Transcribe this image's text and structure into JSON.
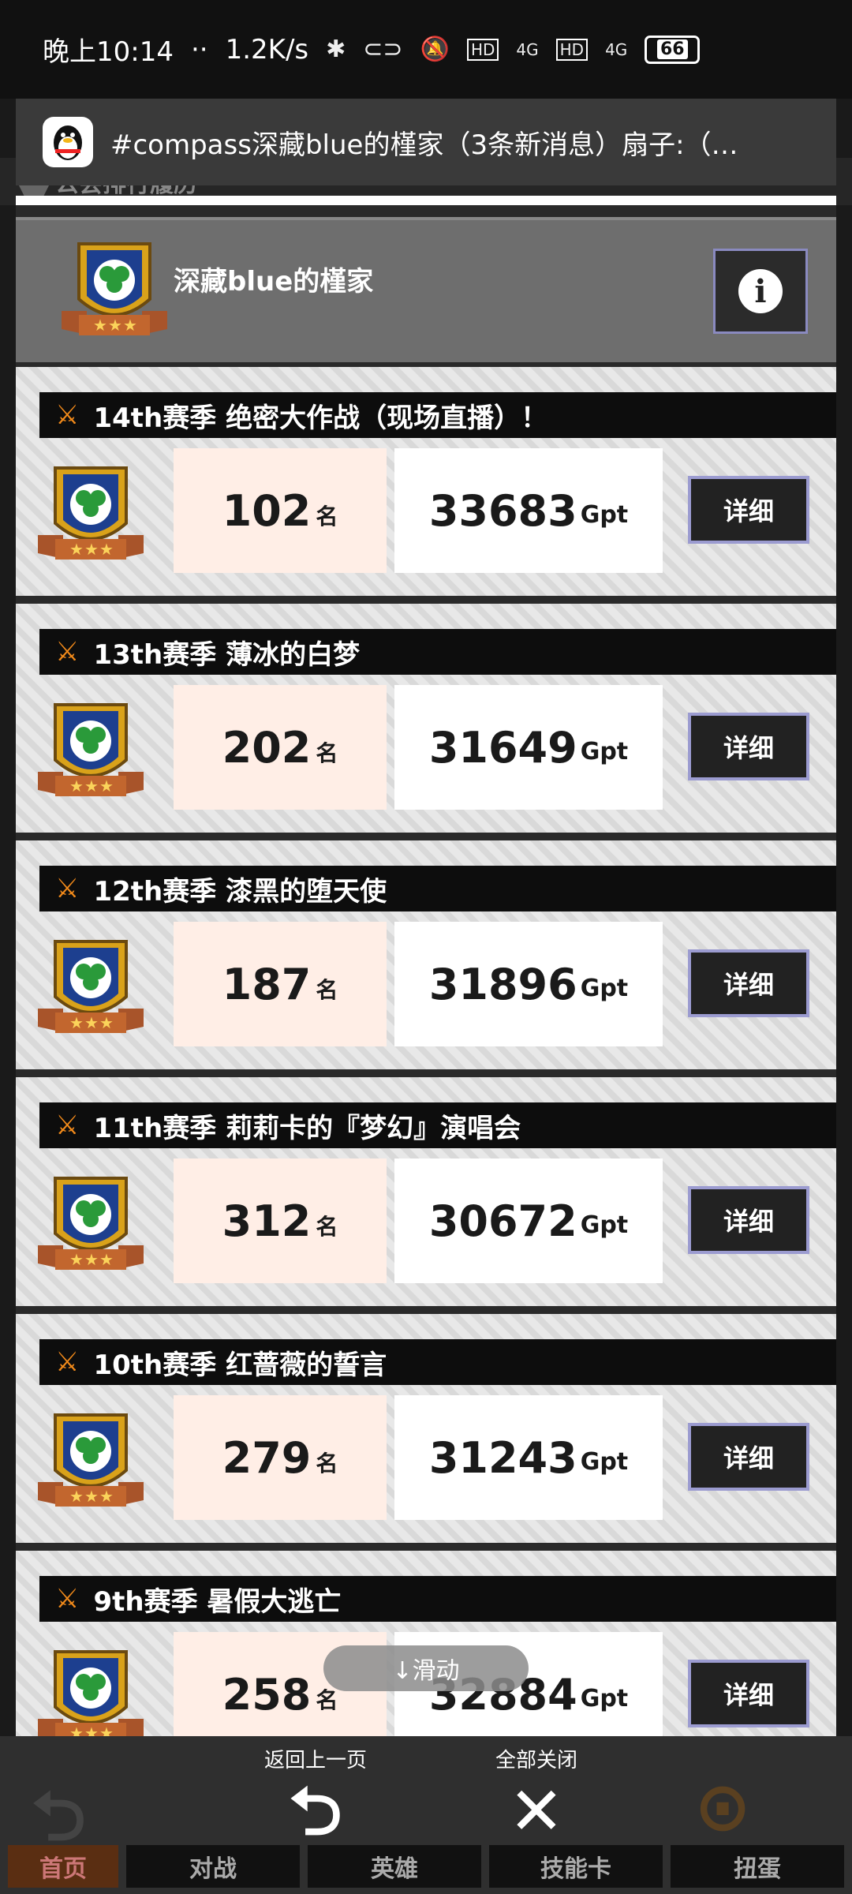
{
  "status_bar": {
    "time": "晚上10:14",
    "dots": "··",
    "net_speed": "1.2K/s",
    "hd1": "HD",
    "net1": "4G",
    "hd2": "HD",
    "net2": "4G",
    "battery": "66"
  },
  "notification": {
    "app_icon": "qq-penguin-icon",
    "text": "#compass深藏blue的槿家（3条新消息）扇子:（…"
  },
  "header": {
    "title": "公会排行履历"
  },
  "guild": {
    "name": "深藏blue的槿家",
    "info_icon": "info-icon"
  },
  "seasons": [
    {
      "title": "14th赛季  绝密大作战（现场直播）！",
      "rank": "102",
      "rank_unit": "名",
      "score": "33683",
      "score_unit": "Gpt",
      "detail_label": "详细"
    },
    {
      "title": "13th赛季  薄冰的白梦",
      "rank": "202",
      "rank_unit": "名",
      "score": "31649",
      "score_unit": "Gpt",
      "detail_label": "详细"
    },
    {
      "title": "12th赛季  漆黑的堕天使",
      "rank": "187",
      "rank_unit": "名",
      "score": "31896",
      "score_unit": "Gpt",
      "detail_label": "详细"
    },
    {
      "title": "11th赛季  莉莉卡的『梦幻』演唱会",
      "rank": "312",
      "rank_unit": "名",
      "score": "30672",
      "score_unit": "Gpt",
      "detail_label": "详细"
    },
    {
      "title": "10th赛季  红蔷薇的誓言",
      "rank": "279",
      "rank_unit": "名",
      "score": "31243",
      "score_unit": "Gpt",
      "detail_label": "详细"
    },
    {
      "title": "9th赛季  暑假大逃亡",
      "rank": "258",
      "rank_unit": "名",
      "score": "32884",
      "score_unit": "Gpt",
      "detail_label": "详细"
    }
  ],
  "scroll_hint": "↓滑动",
  "bottom_actions": {
    "back_label": "返回上一页",
    "close_all_label": "全部关闭"
  },
  "nav": [
    "首页",
    "对战",
    "英雄",
    "技能卡",
    "扭蛋"
  ],
  "colors": {
    "accent_orange": "#f28a1a",
    "title_bar": "#0d0d0d",
    "rank_bg": "#ffeee6",
    "button_border": "#9b9bd0"
  }
}
